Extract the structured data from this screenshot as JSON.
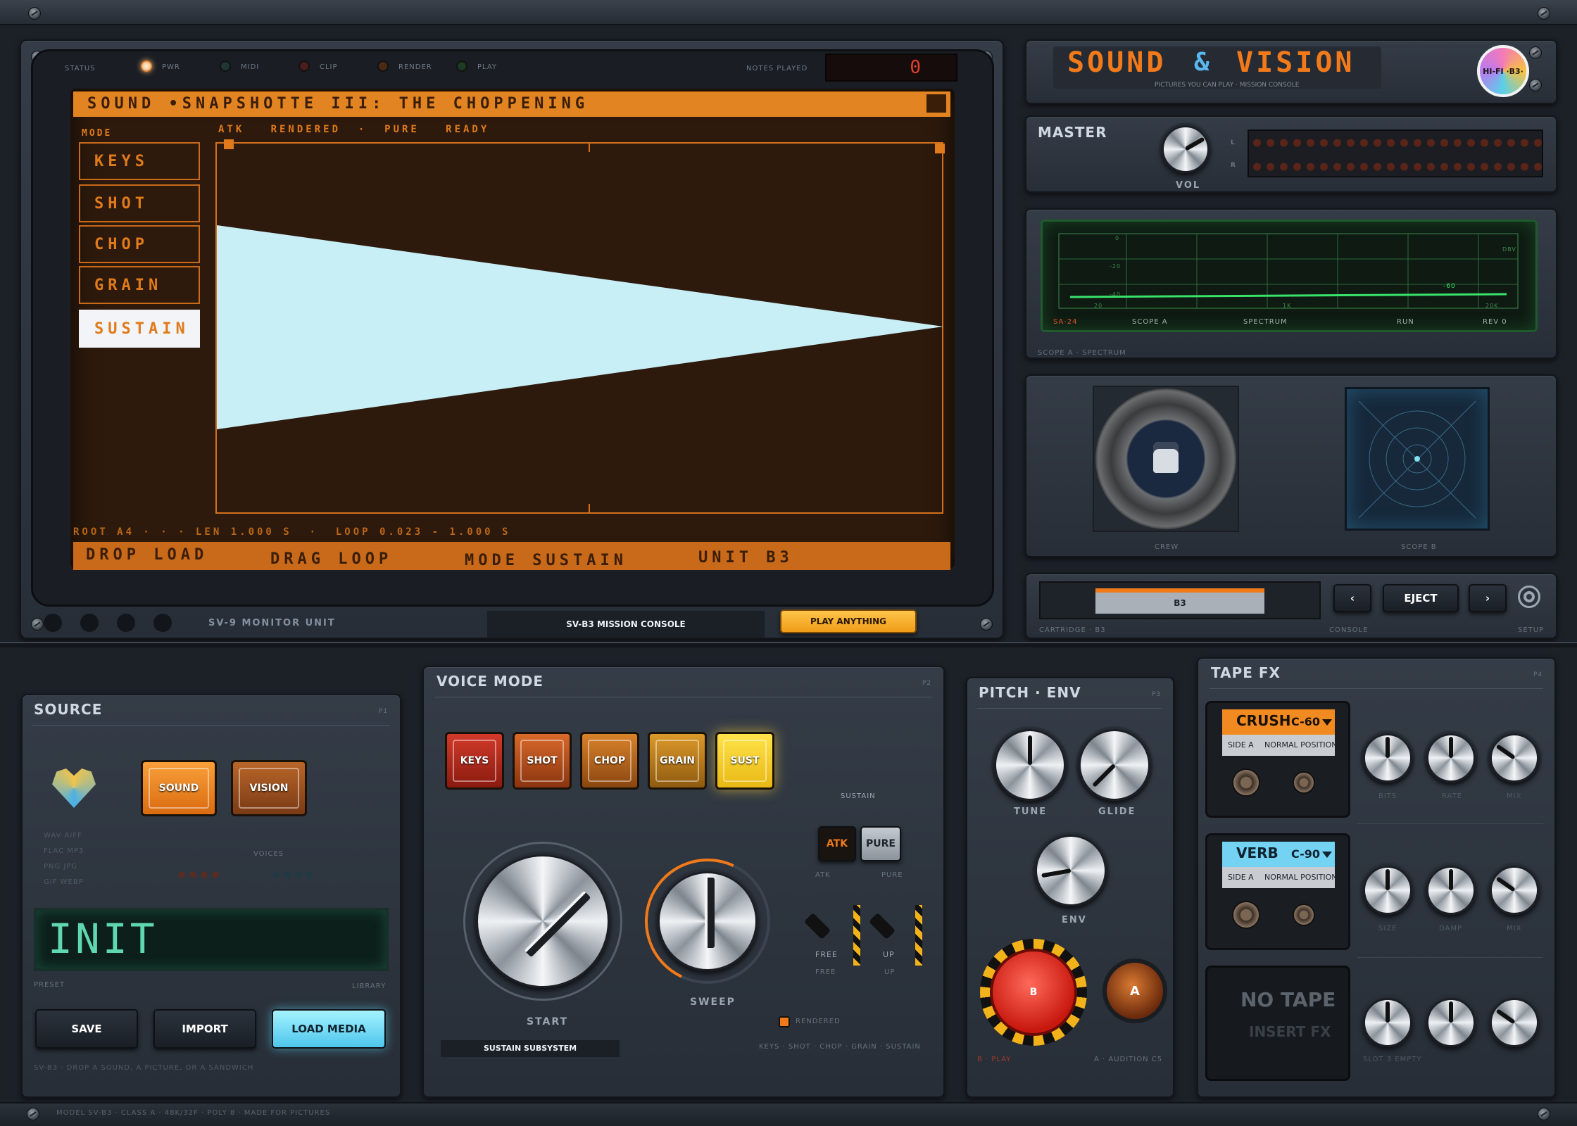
{
  "status": {
    "label": "STATUS",
    "pwr": "PWR",
    "midi": "MIDI",
    "clip": "CLIP",
    "render": "RENDER",
    "play": "PLAY",
    "notes_label": "NOTES PLAYED",
    "notes_value": "0"
  },
  "screen": {
    "title": "SOUND  •SNAPSHOTTE III: THE CHOPPENING",
    "mode_label": "MODE",
    "modes": [
      "KEYS",
      "SHOT",
      "CHOP",
      "GRAIN",
      "SUSTAIN"
    ],
    "selected_mode": "SUSTAIN",
    "header_tags": "ATK   RENDERED  ·  PURE   READY",
    "info": "ROOT A4 · · · LEN 1.000 S  ·  LOOP 0.023 - 1.000 S",
    "footer": [
      "DROP LOAD",
      "DRAG LOOP",
      "MODE SUSTAIN",
      "UNIT B3"
    ]
  },
  "monitor_bar": {
    "unit": "SV-9 MONITOR UNIT",
    "console": "SV-B3 MISSION CONSOLE",
    "play_btn": "PLAY ANYTHING"
  },
  "brand": {
    "title_a": "SOUND",
    "amp": "&",
    "title_b": "VISION",
    "subtitle": "PICTURES YOU CAN PLAY · MISSION CONSOLE",
    "badge": "HI-FI ·B3·"
  },
  "master": {
    "title": "MASTER",
    "vol": "VOL",
    "l": "L",
    "r": "R"
  },
  "scope": {
    "top_labels": [
      "0",
      "-20",
      "-40"
    ],
    "bottom_left": "20",
    "bottom_mid": "1K",
    "bottom_right": "20K",
    "value": "-60",
    "dbv": "DBV",
    "model": "SA-24",
    "a": "SCOPE A",
    "spectrum": "SPECTRUM",
    "run": "RUN",
    "rev": "REV 0",
    "caption": "SCOPE A · SPECTRUM"
  },
  "crew": {
    "crew": "CREW",
    "scope_b": "SCOPE B"
  },
  "cartridge": {
    "value": "B3",
    "prev": "‹",
    "eject": "EJECT",
    "next": "›",
    "cart_lbl": "CARTRIDGE · B3",
    "console_lbl": "CONSOLE",
    "setup_lbl": "SETUP"
  },
  "source": {
    "title": "SOURCE",
    "tag": "P1",
    "sound": "SOUND",
    "vision": "VISION",
    "formats": [
      "WAV AIFF",
      "FLAC MP3",
      "PNG JPG",
      "GIF WEBP"
    ],
    "voices": "VOICES",
    "lcd": "INIT",
    "preset": "PRESET",
    "library": "LIBRARY",
    "save": "SAVE",
    "import": "IMPORT",
    "load": "LOAD MEDIA",
    "footer": "SV-B3 · DROP A SOUND, A PICTURE, OR A SANDWICH"
  },
  "voice": {
    "title": "VOICE MODE",
    "tag": "P2",
    "keys": "KEYS",
    "shot": "SHOT",
    "chop": "CHOP",
    "grain": "GRAIN",
    "sust": "SUST",
    "sustain": "SUSTAIN",
    "atk": "ATK",
    "pure": "PURE",
    "atk_lbl": "ATK",
    "pure_lbl": "PURE",
    "free": "FREE",
    "free2": "FREE",
    "up": "UP",
    "up2": "UP",
    "start": "START",
    "sweep": "SWEEP",
    "rendered": "RENDERED",
    "subsystem": "SUSTAIN SUBSYSTEM",
    "modes_line": "KEYS · SHOT · CHOP · GRAIN · SUSTAIN"
  },
  "pitch": {
    "title": "PITCH · ENV",
    "tag": "P3",
    "tune": "TUNE",
    "glide": "GLIDE",
    "env": "ENV",
    "b": "B",
    "a": "A",
    "b_lbl": "B · PLAY",
    "a_lbl": "A · AUDITION C5"
  },
  "tapefx": {
    "title": "TAPE FX",
    "tag": "P4",
    "t1": {
      "name": "CRUSH",
      "len": "C-60",
      "side": "SIDE A",
      "pos": "NORMAL POSITION",
      "k": [
        "BITS",
        "RATE",
        "MIX"
      ]
    },
    "t2": {
      "name": "VERB",
      "len": "C-90",
      "side": "SIDE A",
      "pos": "NORMAL POSITION",
      "k": [
        "SIZE",
        "DAMP",
        "MIX"
      ]
    },
    "t3": {
      "name": "NO TAPE",
      "sub": "INSERT FX",
      "k": "SLOT 3 EMPTY"
    }
  },
  "footer": {
    "text": "MODEL SV-B3 · CLASS A · 48K/32F · POLY 8 · MADE FOR PICTURES"
  }
}
